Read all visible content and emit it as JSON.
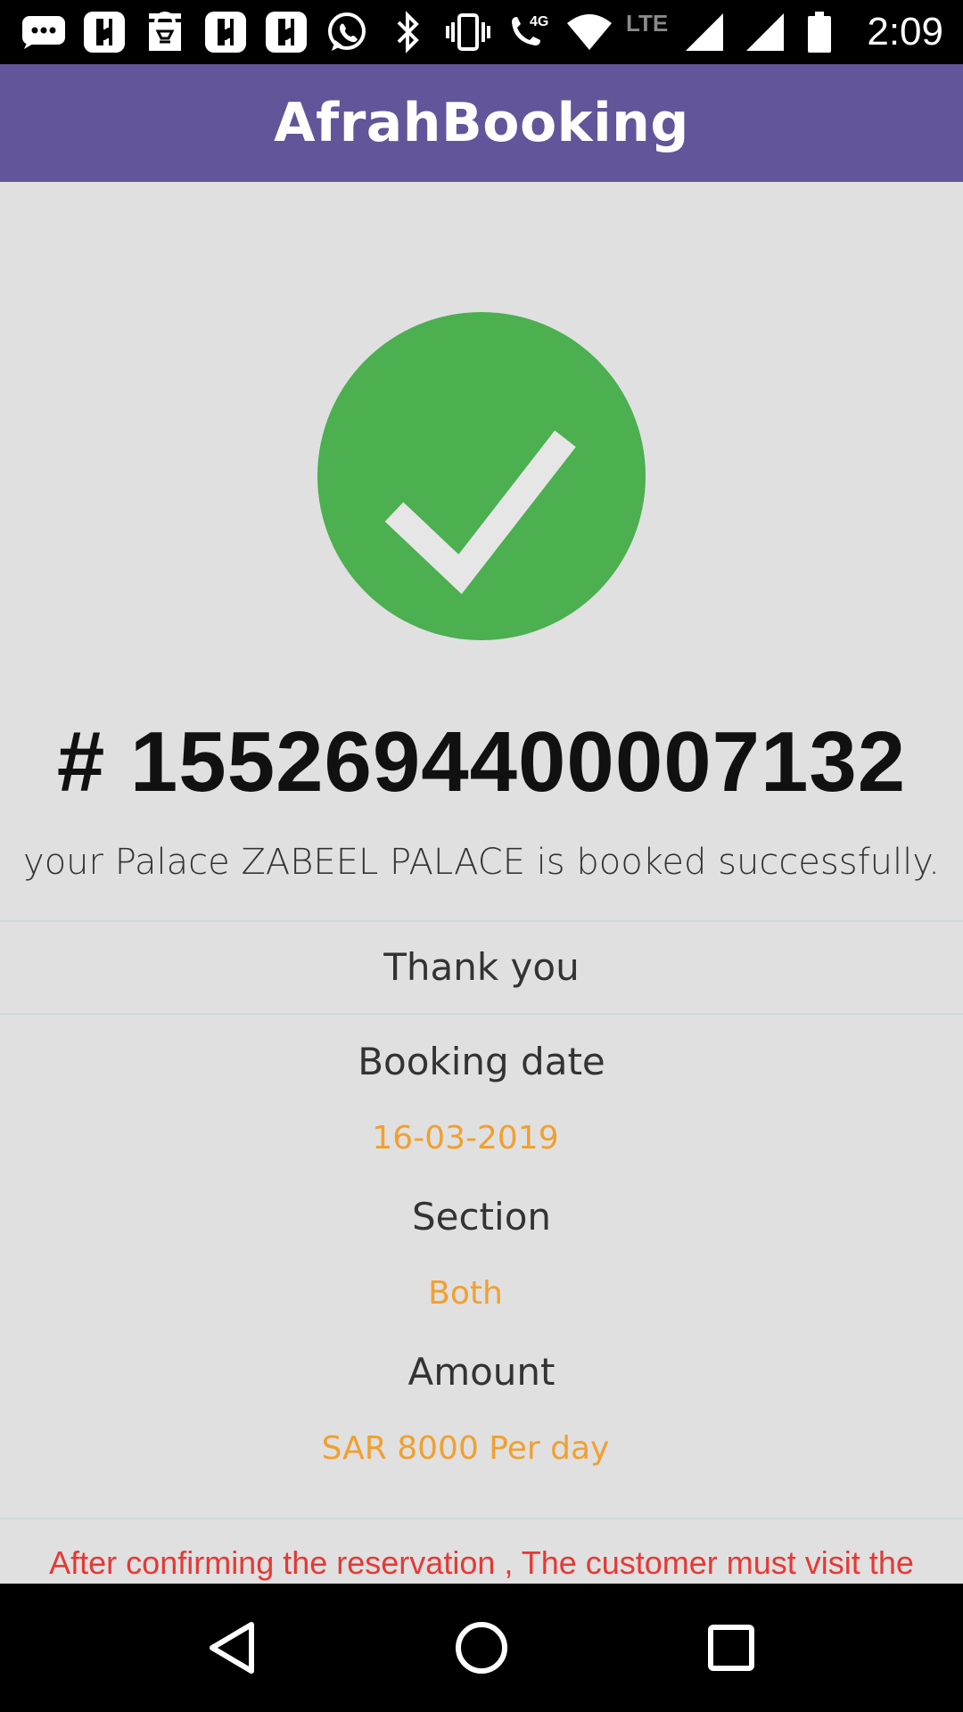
{
  "status_bar": {
    "time": "2:09",
    "network_label": "LTE",
    "icons": [
      "message-icon",
      "app-icon",
      "store-icon",
      "app-icon",
      "app-icon",
      "whatsapp-icon",
      "bluetooth-icon",
      "vibrate-icon",
      "wifi-call-icon",
      "wifi-icon",
      "signal-icon",
      "signal-icon",
      "battery-icon"
    ]
  },
  "app_bar": {
    "title": "AfrahBooking"
  },
  "confirmation": {
    "icon": "check-icon",
    "accent_color": "#4caf50",
    "booking_number": "# 1552694400007132",
    "message": "your Palace ZABEEL PALACE is booked successfully.",
    "thanks": "Thank you"
  },
  "details": {
    "booking_date_label": "Booking date",
    "booking_date_value": "16-03-2019",
    "section_label": "Section",
    "section_value": "Both",
    "amount_label": "Amount",
    "amount_value": "SAR 8000 Per day",
    "value_color": "#f0a030"
  },
  "notice": {
    "text": "After confirming the reservation , The customer must visit the",
    "color": "#e53935"
  },
  "nav_bar": {
    "buttons": [
      "back-icon",
      "home-icon",
      "recents-icon"
    ]
  }
}
